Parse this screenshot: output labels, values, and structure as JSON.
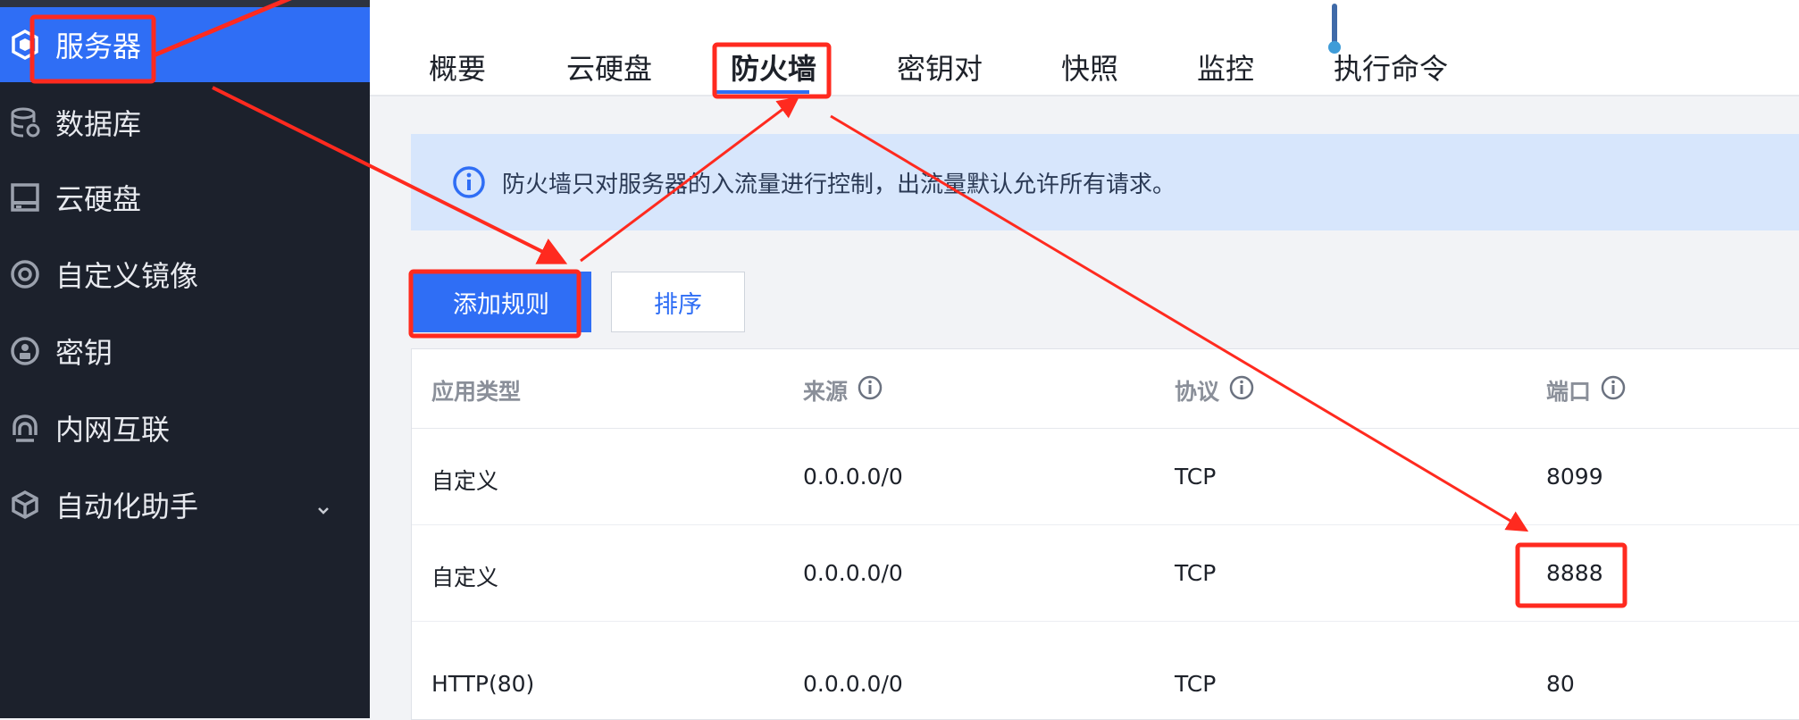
{
  "sidebar": {
    "items": [
      {
        "label": "服务器",
        "icon": "server-box-icon",
        "active": true
      },
      {
        "label": "数据库",
        "icon": "database-icon",
        "active": false
      },
      {
        "label": "云硬盘",
        "icon": "disk-icon",
        "active": false
      },
      {
        "label": "自定义镜像",
        "icon": "image-disc-icon",
        "active": false
      },
      {
        "label": "密钥",
        "icon": "key-icon",
        "active": false
      },
      {
        "label": "内网互联",
        "icon": "network-link-icon",
        "active": false
      },
      {
        "label": "自动化助手",
        "icon": "automation-cube-icon",
        "active": false
      }
    ]
  },
  "tabs": [
    "概要",
    "云硬盘",
    "防火墙",
    "密钥对",
    "快照",
    "监控",
    "执行命令"
  ],
  "active_tab": "防火墙",
  "notice": {
    "text": "防火墙只对服务器的入流量进行控制，出流量默认允许所有请求。"
  },
  "buttons": {
    "add_rule": "添加规则",
    "sort": "排序"
  },
  "table": {
    "columns": [
      "应用类型",
      "来源",
      "协议",
      "端口"
    ],
    "rows": [
      [
        "自定义",
        "0.0.0.0/0",
        "TCP",
        "8099"
      ],
      [
        "自定义",
        "0.0.0.0/0",
        "TCP",
        "8888"
      ],
      [
        "HTTP(80)",
        "0.0.0.0/0",
        "TCP",
        "80"
      ]
    ]
  },
  "colors": {
    "accent": "#2f6ef5",
    "sidebar_bg": "#1c212c",
    "annotation": "#ff2a1f",
    "notice_bg": "#d7e6fc"
  }
}
